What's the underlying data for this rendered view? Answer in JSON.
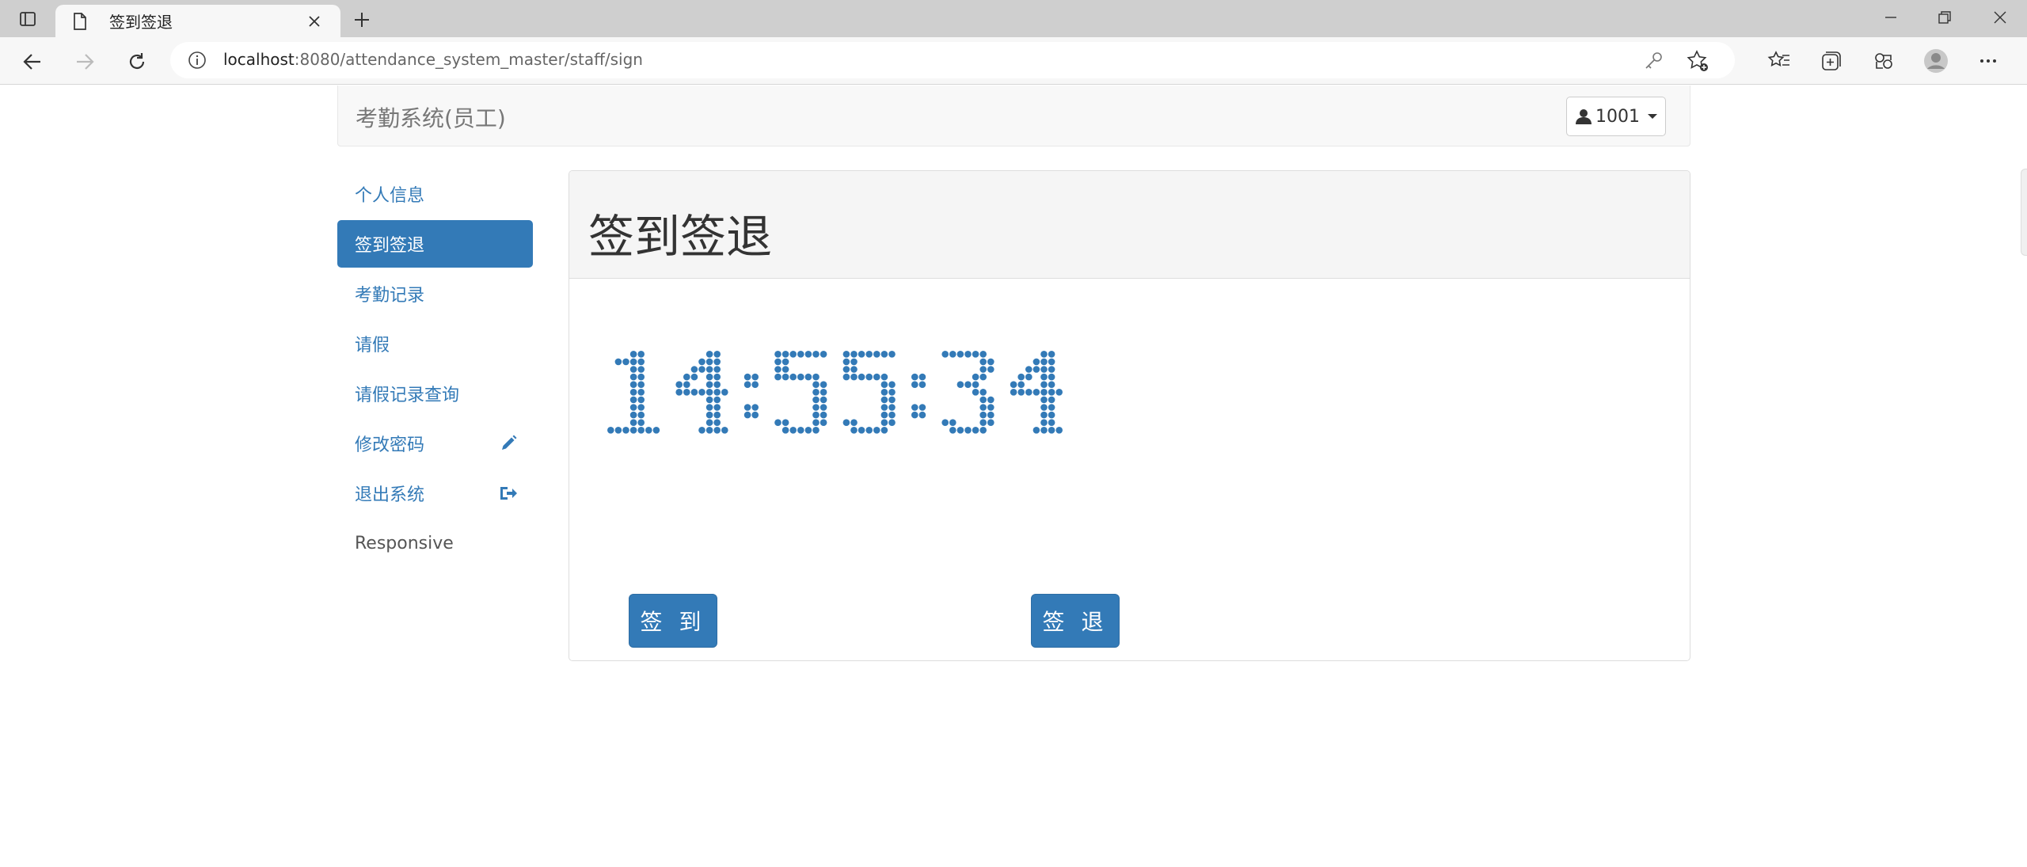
{
  "browser": {
    "tab_title": "签到签退",
    "url_host": "localhost",
    "url_rest": ":8080/attendance_system_master/staff/sign"
  },
  "navbar": {
    "brand": "考勤系统(员工)",
    "user": "1001"
  },
  "sidebar": {
    "items": [
      {
        "label": "个人信息"
      },
      {
        "label": "签到签退"
      },
      {
        "label": "考勤记录"
      },
      {
        "label": "请假"
      },
      {
        "label": "请假记录查询"
      },
      {
        "label": "修改密码",
        "icon": "pencil-icon"
      },
      {
        "label": "退出系统",
        "icon": "log-out-icon"
      },
      {
        "label": "Responsive"
      }
    ]
  },
  "panel": {
    "title": "签到签退",
    "clock_time": "14:55:34",
    "sign_in_label": "签 到",
    "sign_out_label": "签 退"
  },
  "colors": {
    "primary": "#337ab7",
    "navbar_bg": "#f8f8f8",
    "tabstrip_bg": "#cfcfcf"
  }
}
